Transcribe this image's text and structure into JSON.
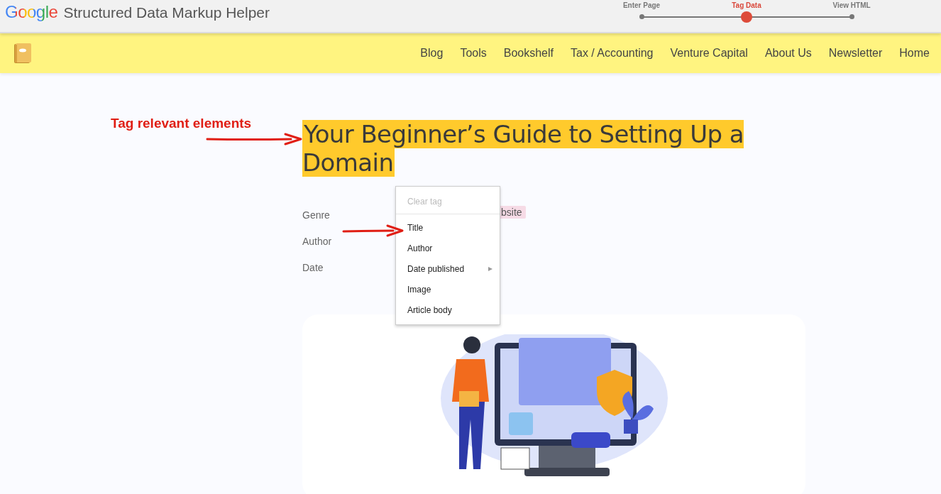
{
  "header": {
    "logo": "Google",
    "title": "Structured Data Markup Helper"
  },
  "steps": [
    {
      "label": "Enter Page",
      "selected": false
    },
    {
      "label": "Tag Data",
      "selected": true
    },
    {
      "label": "View HTML",
      "selected": false
    }
  ],
  "nav": {
    "items": [
      "Blog",
      "Tools",
      "Bookshelf",
      "Tax / Accounting",
      "Venture Capital",
      "About Us",
      "Newsletter",
      "Home"
    ]
  },
  "annotation": {
    "text": "Tag relevant elements"
  },
  "article": {
    "title": "Your Beginner’s Guide to Setting Up a Domain",
    "title_tagged": true,
    "fields": [
      {
        "label": "Genre",
        "value": "bsite"
      },
      {
        "label": "Author"
      },
      {
        "label": "Date"
      }
    ]
  },
  "context_menu": {
    "items": [
      {
        "label": "Clear tag",
        "disabled": true,
        "has_submenu": false
      },
      {
        "label": "Title",
        "disabled": false,
        "has_submenu": false
      },
      {
        "label": "Author",
        "disabled": false,
        "has_submenu": false
      },
      {
        "label": "Date published",
        "disabled": false,
        "has_submenu": true
      },
      {
        "label": "Image",
        "disabled": false,
        "has_submenu": false
      },
      {
        "label": "Article body",
        "disabled": false,
        "has_submenu": false
      }
    ]
  }
}
